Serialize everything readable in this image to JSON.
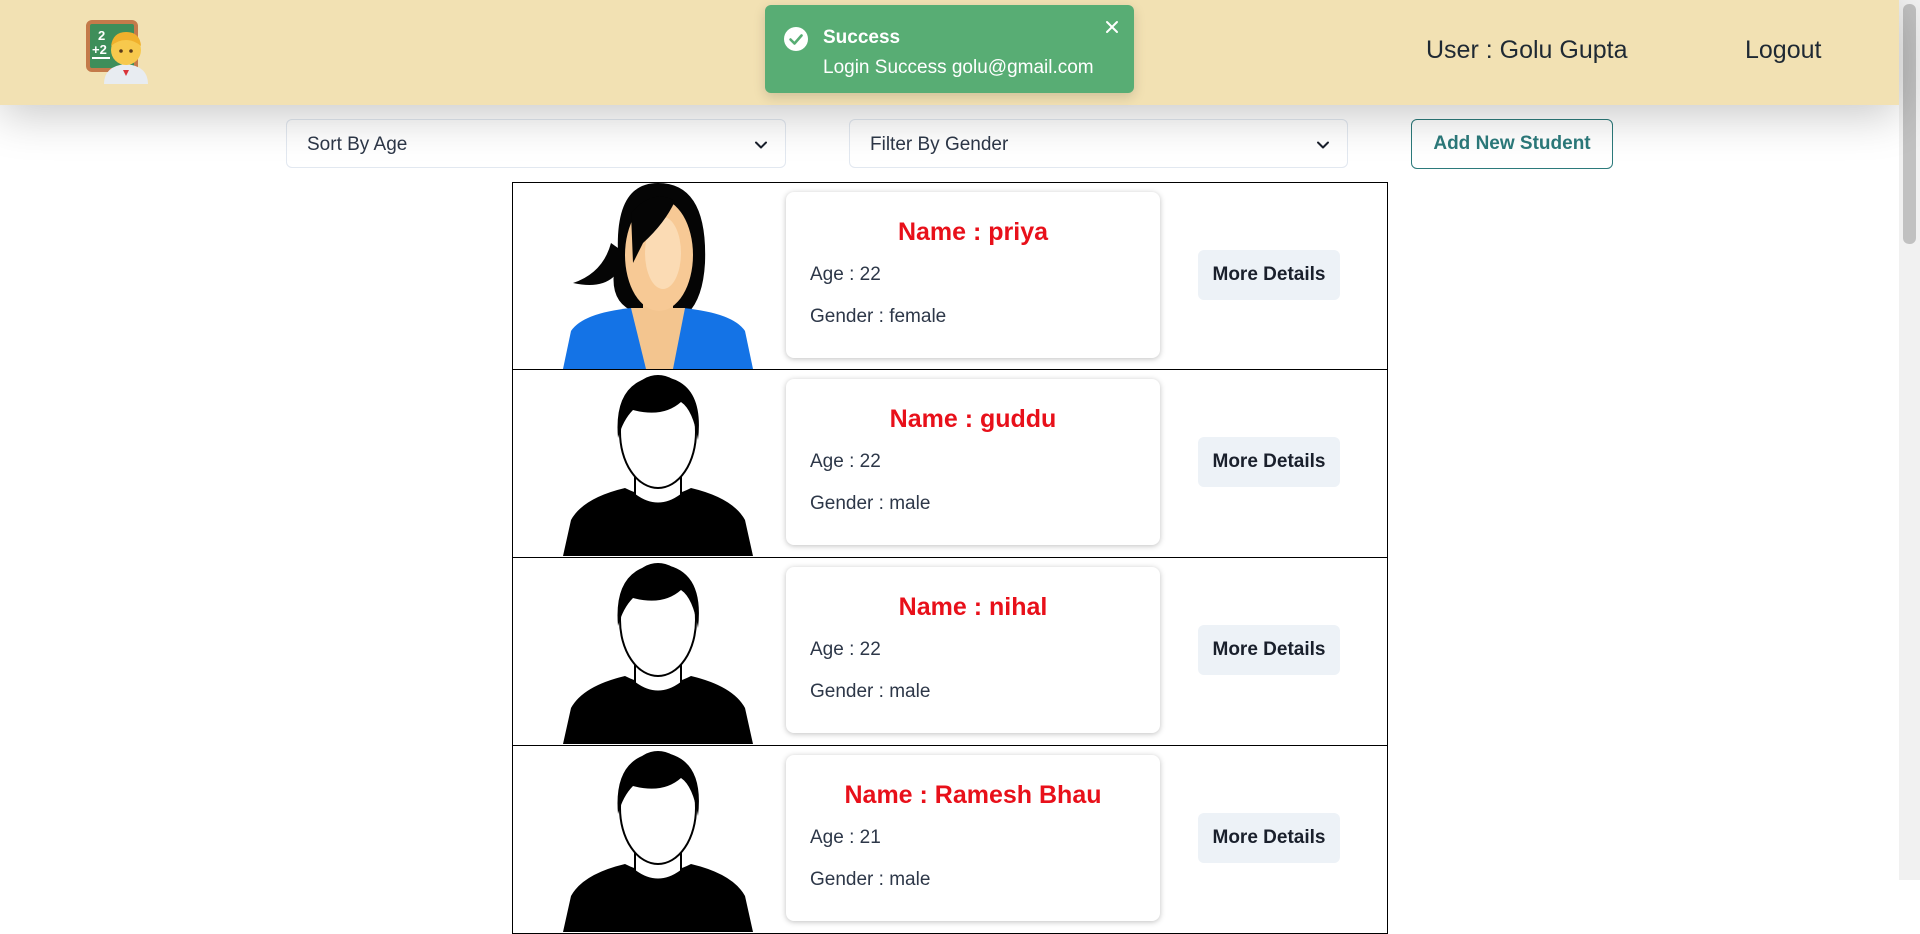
{
  "header": {
    "user_label": "User : Golu Gupta",
    "logout_label": "Logout"
  },
  "toast": {
    "title": "Success",
    "message": "Login Success golu@gmail.com",
    "color": "#58ad74"
  },
  "controls": {
    "sort_label": "Sort By Age",
    "filter_label": "Filter By Gender",
    "add_label": "Add New Student"
  },
  "students": [
    {
      "name": "Name : priya",
      "age": "Age : 22",
      "gender": "Gender : female",
      "avatar": "female-avatar-icon",
      "button": "More Details"
    },
    {
      "name": "Name : guddu",
      "age": "Age : 22",
      "gender": "Gender : male",
      "avatar": "male-avatar-icon",
      "button": "More Details"
    },
    {
      "name": "Name : nihal",
      "age": "Age : 22",
      "gender": "Gender : male",
      "avatar": "male-avatar-icon",
      "button": "More Details"
    },
    {
      "name": "Name : Ramesh Bhau",
      "age": "Age : 21",
      "gender": "Gender : male",
      "avatar": "male-avatar-icon",
      "button": "More Details"
    }
  ],
  "colors": {
    "header_bg": "#f2e1b3",
    "name_red": "#e8101a",
    "accent_teal": "#2c7a7b"
  }
}
